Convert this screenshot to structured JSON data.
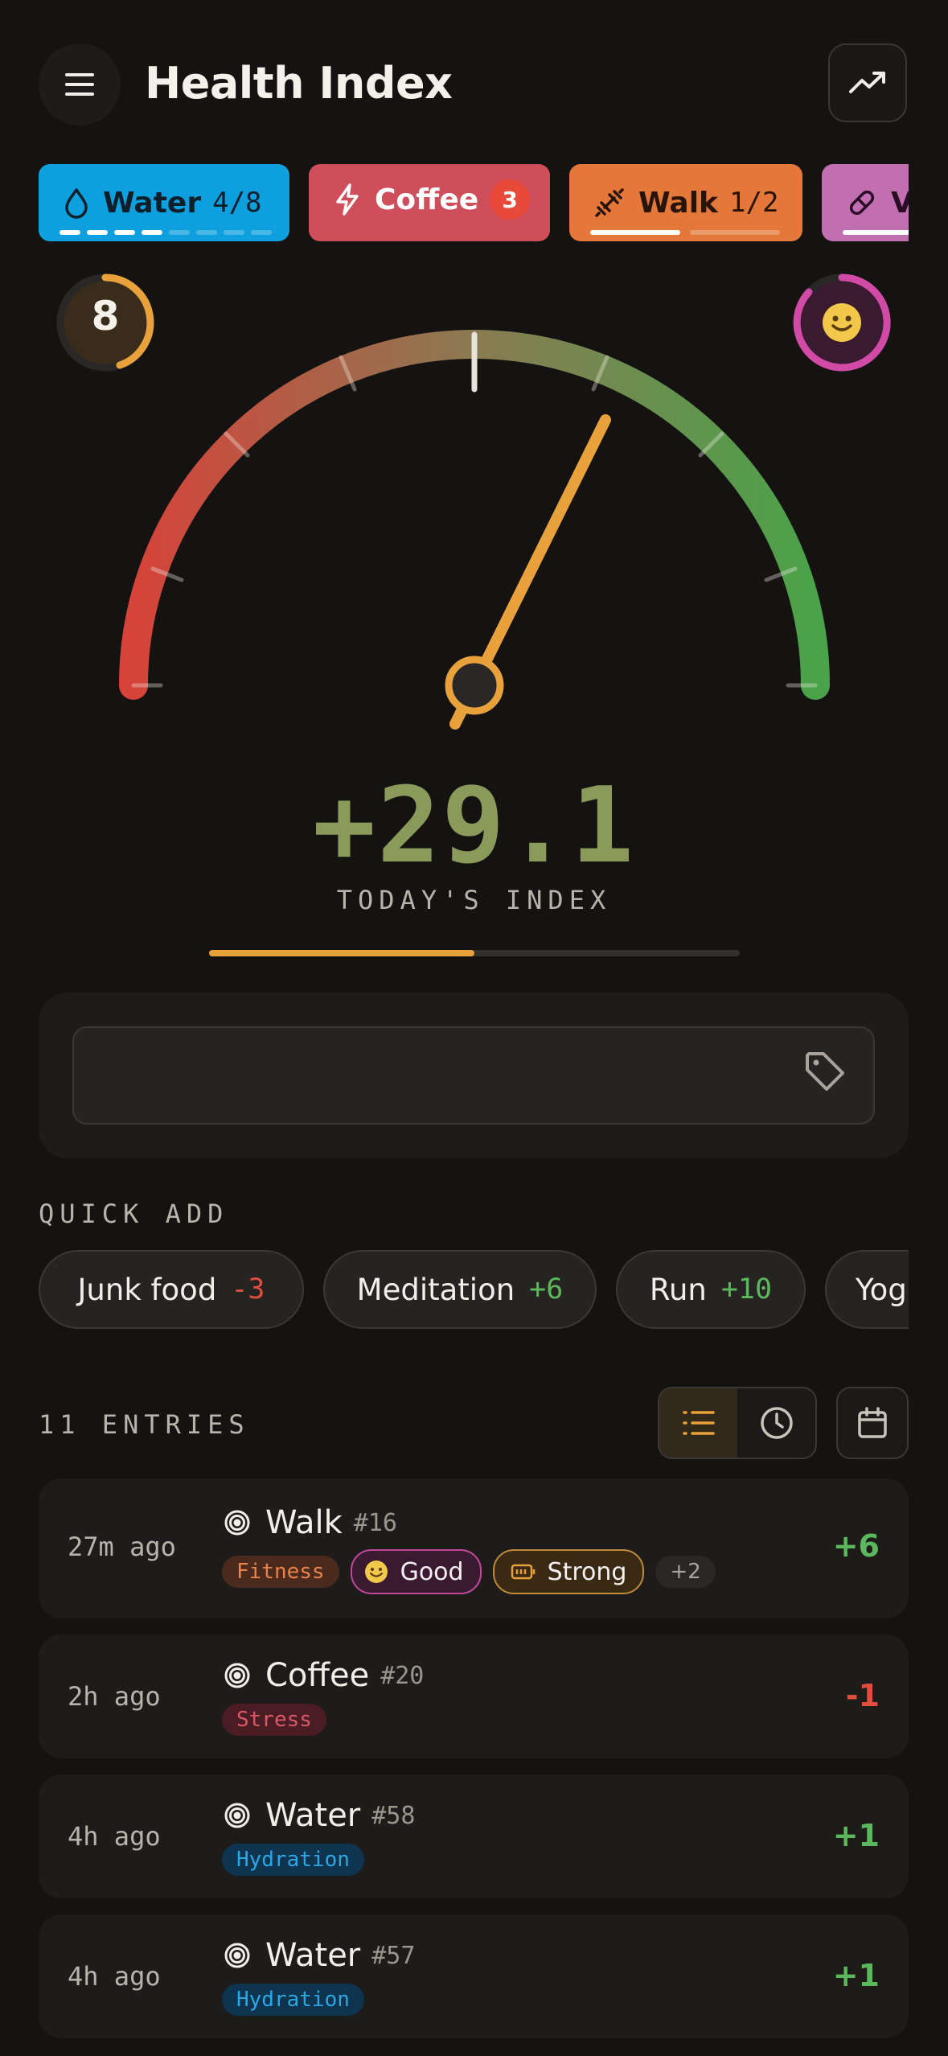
{
  "header": {
    "title": "Health Index",
    "menu_icon": "hamburger-icon",
    "trend_icon": "trending-up-icon"
  },
  "habits": [
    {
      "label": "Water",
      "count": "4/8",
      "icon": "droplet-icon",
      "color": "#0ea0de",
      "progress": 0.5
    },
    {
      "label": "Coffee",
      "badge": "3",
      "icon": "lightning-icon",
      "color": "#cf4e5c"
    },
    {
      "label": "Walk",
      "count": "1/2",
      "icon": "dumbbell-icon",
      "color": "#e4783a",
      "progress": 0.5
    },
    {
      "label": "V",
      "icon": "pill-icon",
      "color": "#c26fb2"
    }
  ],
  "gauge": {
    "streak_value": "8",
    "mood_icon": "smiley-icon",
    "index_value": "+29.1",
    "index_caption": "TODAY'S INDEX",
    "index_progress": 0.5,
    "colors": {
      "negative": "#d6433a",
      "neutral": "#8a8050",
      "positive": "#4aa34a",
      "needle": "#e9a23b"
    }
  },
  "note_input": {
    "value": "",
    "placeholder": "",
    "icon": "tag-icon"
  },
  "quick_add": {
    "title": "QUICK ADD",
    "items": [
      {
        "label": "Junk food",
        "delta": "-3"
      },
      {
        "label": "Meditation",
        "delta": "+6"
      },
      {
        "label": "Run",
        "delta": "+10"
      },
      {
        "label": "Yog",
        "delta": ""
      }
    ]
  },
  "entries_header": {
    "count_label": "11 ENTRIES",
    "list_icon": "list-icon",
    "clock_icon": "clock-icon",
    "calendar_icon": "calendar-icon"
  },
  "entries": [
    {
      "time": "27m ago",
      "name": "Walk",
      "number": "#16",
      "score": "+6",
      "tags": [
        "Fitness"
      ],
      "mood": "Good",
      "energy": "Strong",
      "more": "+2"
    },
    {
      "time": "2h ago",
      "name": "Coffee",
      "number": "#20",
      "score": "-1",
      "tags": [
        "Stress"
      ]
    },
    {
      "time": "4h ago",
      "name": "Water",
      "number": "#58",
      "score": "+1",
      "tags": [
        "Hydration"
      ]
    },
    {
      "time": "4h ago",
      "name": "Water",
      "number": "#57",
      "score": "+1",
      "tags": [
        "Hydration"
      ]
    }
  ]
}
